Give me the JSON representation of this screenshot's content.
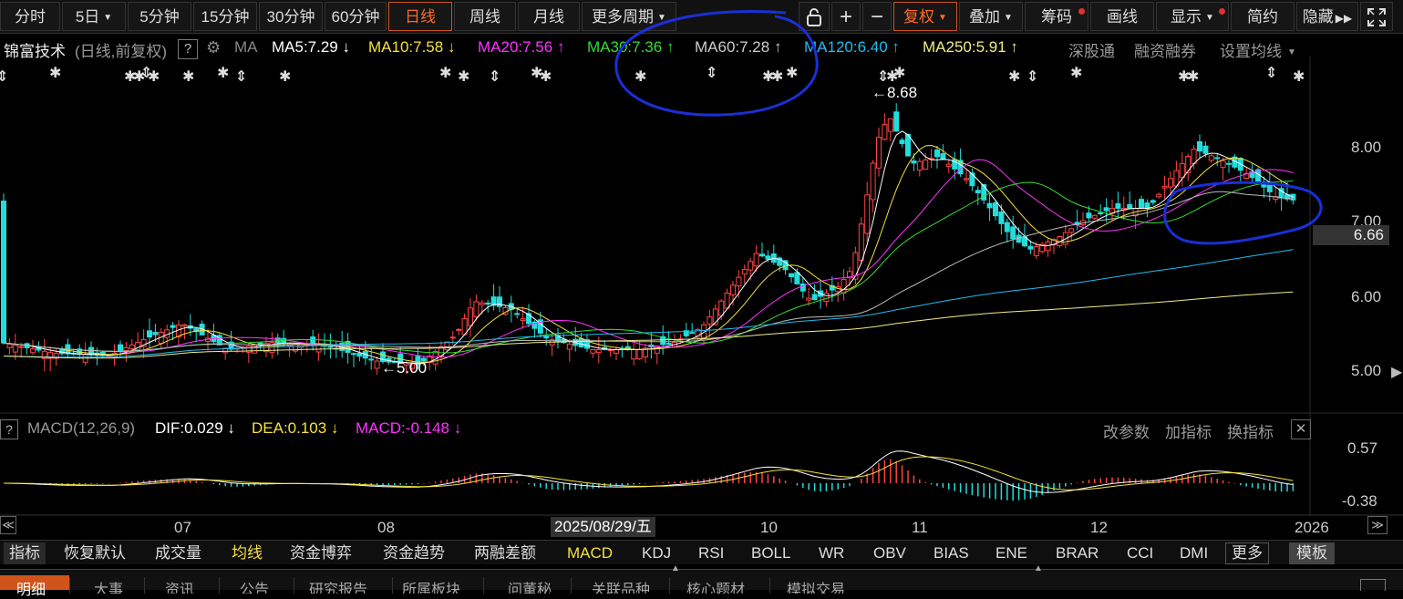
{
  "toolbar": {
    "periods": [
      "分时",
      "5日",
      "5分钟",
      "15分钟",
      "30分钟",
      "60分钟",
      "日线",
      "周线",
      "月线",
      "更多周期"
    ],
    "active_period": "日线",
    "tools": [
      "复权",
      "叠加",
      "筹码",
      "画线",
      "显示",
      "简约",
      "隐藏"
    ]
  },
  "legend": {
    "stock_name": "锦富技术",
    "mode": "(日线,前复权)",
    "help": "?",
    "ma_label": "MA",
    "ma5": "MA5:7.29 ↓",
    "ma10": "MA10:7.58 ↓",
    "ma20": "MA20:7.56 ↑",
    "ma30": "MA30:7.36 ↑",
    "ma60": "MA60:7.28 ↑",
    "ma120": "MA120:6.40 ↑",
    "ma250": "MA250:5.91 ↑",
    "link1": "深股通",
    "link2": "融资融券",
    "link3": "设置均线"
  },
  "colors": {
    "ma5": "#ffffff",
    "ma10": "#f5e13a",
    "ma20": "#ff33ff",
    "ma30": "#33dd33",
    "ma60": "#bbbbbb",
    "ma120": "#22bbee",
    "ma250": "#eeee88",
    "up": "#ff4444",
    "down": "#22dddd",
    "annotation": "#1a2fd6"
  },
  "price_chart": {
    "high_label": "8.68",
    "low_label": "5.00",
    "y_ticks": [
      "8.00",
      "7.00",
      "6.00",
      "5.00"
    ],
    "current_price": "6.66"
  },
  "macd": {
    "title": "MACD(12,26,9)",
    "dif": "DIF:0.029 ↓",
    "dea": "DEA:0.103 ↓",
    "macd": "MACD:-0.148 ↓",
    "actions": [
      "改参数",
      "加指标",
      "换指标"
    ],
    "y_ticks": [
      "0.57",
      "-0.38"
    ]
  },
  "x_axis": {
    "ticks": [
      "07",
      "08",
      "10",
      "11",
      "12",
      "2026"
    ],
    "cursor_date": "2025/08/29/五"
  },
  "indicators": [
    "指标",
    "恢复默认",
    "成交量",
    "均线",
    "资金博弈",
    "资金趋势",
    "两融差额",
    "MACD",
    "KDJ",
    "RSI",
    "BOLL",
    "WR",
    "OBV",
    "BIAS",
    "ENE",
    "BRAR",
    "CCI",
    "DMI",
    "更多",
    "模板"
  ],
  "bottom_tabs": [
    "明细",
    "大事",
    "资讯",
    "公告",
    "研究报告",
    "所属板块",
    "问董秘",
    "关联品种",
    "核心题材",
    "模拟交易"
  ]
}
